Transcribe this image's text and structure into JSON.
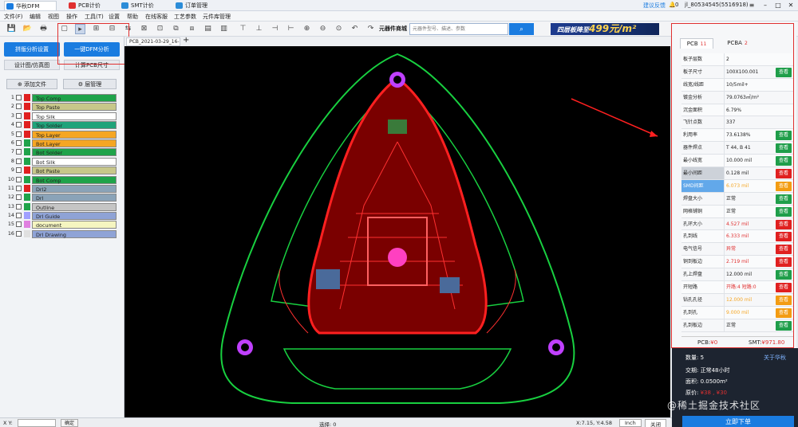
{
  "titlebar": {
    "tabs": [
      "华秋DFM",
      "PCB计价",
      "SMT计价",
      "订单管理"
    ],
    "feedback": "建议反馈",
    "notifications": "0",
    "user": "jl_80534545(5516918)",
    "colors": {
      "dfm": "#1a7ce0",
      "pcb": "#e03030",
      "smt": "#2b8cd8",
      "order": "#2b8cd8"
    }
  },
  "menu": [
    "文件(F)",
    "编辑",
    "视图",
    "操作",
    "工具(T)",
    "设置",
    "帮助",
    "在线客服",
    "工艺参数",
    "元件库管理"
  ],
  "toolbar": {
    "mall_label": "元器件商城",
    "search_placeholder": "元器件型号、描述、参数",
    "ad_text": "四层板降至",
    "ad_price": "499",
    "ad_unit": "元/m²"
  },
  "left": {
    "btn_group": "拼版分析设置",
    "btn_dfm": "一键DFM分析",
    "btn_design": "设计图/仿真图",
    "btn_calc": "计算PCB尺寸",
    "btn_addfile": "添加文件",
    "btn_layers": "层管理",
    "layers": [
      {
        "num": "1",
        "name": "Top Comp",
        "color": "#e02020",
        "bg": "#1fa34a"
      },
      {
        "num": "2",
        "name": "Top Paste",
        "color": "#e02020",
        "bg": "#c7c78a"
      },
      {
        "num": "3",
        "name": "Top Silk",
        "color": "#e02020",
        "bg": "#ffffff"
      },
      {
        "num": "4",
        "name": "Top Solder",
        "color": "#e02020",
        "bg": "#1fa37a"
      },
      {
        "num": "5",
        "name": "Top Layer",
        "color": "#e02020",
        "bg": "#f5a623"
      },
      {
        "num": "6",
        "name": "Bot Layer",
        "color": "#1fa34a",
        "bg": "#f5a623"
      },
      {
        "num": "7",
        "name": "Bot Solder",
        "color": "#1fa34a",
        "bg": "#1fa34a"
      },
      {
        "num": "8",
        "name": "Bot Silk",
        "color": "#1fa34a",
        "bg": "#ffffff"
      },
      {
        "num": "9",
        "name": "Bot Paste",
        "color": "#e02020",
        "bg": "#c7c78a"
      },
      {
        "num": "10",
        "name": "Bot Comp",
        "color": "#1fa34a",
        "bg": "#1fa34a"
      },
      {
        "num": "11",
        "name": "Drl2",
        "color": "#e02020",
        "bg": "#8aa3b8"
      },
      {
        "num": "12",
        "name": "Drl",
        "color": "#1fa34a",
        "bg": "#8aa3b8"
      },
      {
        "num": "13",
        "name": "Outline",
        "color": "#1fa34a",
        "bg": "#c5c5c5"
      },
      {
        "num": "14",
        "name": "Drl Guide",
        "color": "#a0a0ff",
        "bg": "#8fa3d6"
      },
      {
        "num": "15",
        "name": "document",
        "color": "#e080e0",
        "bg": "#f5f5c0"
      },
      {
        "num": "16",
        "name": "Drl Drawing",
        "color": "#e0e0e0",
        "bg": "#8fa3d6"
      }
    ]
  },
  "canvas": {
    "doc_tab": "PCB_2021-03-29_16-3..."
  },
  "right": {
    "tab_pcb": "PCB",
    "tab_pcb_count": "11",
    "tab_pcba": "PCBA",
    "tab_pcba_count": "2",
    "rows": [
      {
        "label": "板子层数",
        "value": "2",
        "btn": "",
        "btn_color": "",
        "value_style": ""
      },
      {
        "label": "板子尺寸",
        "value": "100X100.001",
        "btn": "查看",
        "btn_color": "green",
        "value_style": ""
      },
      {
        "label": "线宽/线距",
        "value": "10/5mil+",
        "btn": "",
        "btn_color": "",
        "value_style": ""
      },
      {
        "label": "镀金分析",
        "value": "79.0763㎡/m²",
        "btn": "",
        "btn_color": "",
        "value_style": ""
      },
      {
        "label": "沉金面积",
        "value": "6.79%",
        "btn": "",
        "btn_color": "",
        "value_style": ""
      },
      {
        "label": "飞针点数",
        "value": "337",
        "btn": "",
        "btn_color": "",
        "value_style": ""
      },
      {
        "label": "利用率",
        "value": "73.6138%",
        "btn": "查看",
        "btn_color": "green",
        "value_style": ""
      },
      {
        "label": "器件焊点",
        "value": "T 44, B 41",
        "btn": "查看",
        "btn_color": "green",
        "value_style": ""
      },
      {
        "label": "最小线宽",
        "value": "10.000 mil",
        "btn": "查看",
        "btn_color": "green",
        "value_style": ""
      },
      {
        "label": "最小间距",
        "value": "0.128 mil",
        "btn": "查看",
        "btn_color": "red",
        "value_style": "",
        "row_style": "sel"
      },
      {
        "label": "SMD间距",
        "value": "6.073 mil",
        "btn": "查看",
        "btn_color": "orange",
        "value_style": "orange",
        "row_style": "blue"
      },
      {
        "label": "焊盘大小",
        "value": "正常",
        "btn": "查看",
        "btn_color": "green",
        "value_style": ""
      },
      {
        "label": "网格铺铜",
        "value": "正常",
        "btn": "查看",
        "btn_color": "green",
        "value_style": ""
      },
      {
        "label": "孔环大小",
        "value": "4.527 mil",
        "btn": "查看",
        "btn_color": "red",
        "value_style": "warn"
      },
      {
        "label": "孔到线",
        "value": "6.333 mil",
        "btn": "查看",
        "btn_color": "red",
        "value_style": "warn"
      },
      {
        "label": "电气信号",
        "value": "异常",
        "btn": "查看",
        "btn_color": "red",
        "value_style": "warn"
      },
      {
        "label": "铜到板边",
        "value": "2.719 mil",
        "btn": "查看",
        "btn_color": "red",
        "value_style": "warn"
      },
      {
        "label": "孔上焊盘",
        "value": "12.000 mil",
        "btn": "查看",
        "btn_color": "green",
        "value_style": ""
      },
      {
        "label": "开短路",
        "value": "开路:4 短路:0",
        "btn": "查看",
        "btn_color": "red",
        "value_style": "warn"
      },
      {
        "label": "钻孔孔径",
        "value": "12.000 mil",
        "btn": "查看",
        "btn_color": "orange",
        "value_style": "orange"
      },
      {
        "label": "孔到孔",
        "value": "9.000 mil",
        "btn": "查看",
        "btn_color": "orange",
        "value_style": "orange"
      },
      {
        "label": "孔到板边",
        "value": "正常",
        "btn": "查看",
        "btn_color": "green",
        "value_style": ""
      }
    ],
    "price_pcb_label": "PCB:",
    "price_pcb": "¥0",
    "price_smt_label": "SMT:",
    "price_smt": "¥971.80",
    "qty_label": "数量:",
    "qty": "5",
    "about": "关于华秋",
    "delivery_label": "交期:",
    "delivery": "正常48小时",
    "area_label": "面积:",
    "area": "0.0500m²",
    "orig_price_label": "原价:",
    "orig_price": "¥38 , ¥30",
    "order_btn": "立即下单"
  },
  "status": {
    "xy_label": "X Y:",
    "confirm": "确定",
    "selected": "选择: 0",
    "coords": "X:7.15, Y:4.58",
    "unit": "Inch",
    "close": "关闭"
  },
  "watermark": "@稀土掘金技术社区"
}
